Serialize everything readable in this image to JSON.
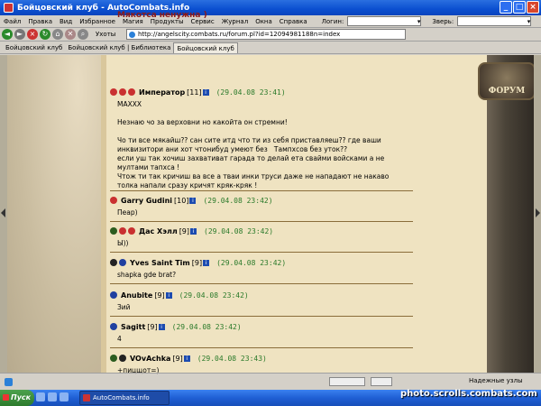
{
  "window": {
    "title": "Бойцовский клуб - AutoCombats.info"
  },
  "menu": {
    "items": [
      "Файл",
      "Правка",
      "Вид",
      "Избранное",
      "Магия",
      "Продукты",
      "Сервис",
      "Журнал",
      "Окна",
      "Справка"
    ],
    "login_label": "Логин:",
    "beast_label": "Зверь:"
  },
  "toolbar": {
    "favorites": "Ухоты",
    "address": "http://angelscity.combats.ru/forum.pl?id=12094981188n=index"
  },
  "tabs": [
    "Бойцовский клуб",
    "Бойцовский клуб | Библиотека",
    "Бойцовский клуб"
  ],
  "thread": {
    "title": "Мякотса ненужна )"
  },
  "posts": [
    {
      "name": "Император",
      "level": "[11]",
      "date": "(29.04.08 23:41)",
      "body": "MAXXX\n\nНезнаю чо за верховни но какойта он стремни!\n\nЧо ти все мякайш?? сан сите итд что ти из себя приставляеш?? где ваши\nинквизитори ани хот чтонибуд умеют без   Тампхсов без уток??\nесли уш так хочиш захвативат гарада то делай ета свайми войсками а не\nмултами тапхса !\nЧтож ти так кричиш ва все а тваи инки труси даже не нападают не накаво\nтолка напали сразу кричят кряк-кряк !"
    },
    {
      "name": "Garry Gudini",
      "level": "[10]",
      "date": "(29.04.08 23:42)",
      "body": "Пеар)"
    },
    {
      "name": "Дас Хэлл",
      "level": "[9]",
      "date": "(29.04.08 23:42)",
      "body": "Ы))"
    },
    {
      "name": "Yves Saint Tim",
      "level": "[9]",
      "date": "(29.04.08 23:42)",
      "body": "shapka gde brat?"
    },
    {
      "name": "Anubite",
      "level": "[9]",
      "date": "(29.04.08 23:42)",
      "body": "Зий"
    },
    {
      "name": "Sagitt",
      "level": "[9]",
      "date": "(29.04.08 23:42)",
      "body": "4"
    },
    {
      "name": "VOvAchka",
      "level": "[9]",
      "date": "(29.04.08 23:43)",
      "body": "+пицщот=)"
    }
  ],
  "logo": {
    "text": "ФОРУМ"
  },
  "status": {
    "zone": "Надежные узлы"
  },
  "taskbar": {
    "start": "Пуск",
    "task": "AutoCombats.info"
  },
  "watermark": "photo.scrolls.combats.com"
}
